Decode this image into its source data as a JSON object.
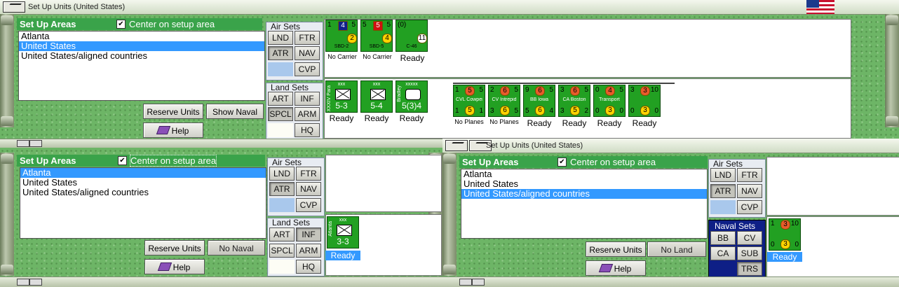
{
  "windows": [
    {
      "id": "top",
      "title": "Set Up Units (United States)",
      "header": "Set Up Areas",
      "center_label": "Center on setup area",
      "center_checked": "✔",
      "areas": [
        "Atlanta",
        "United States",
        "United States/aligned countries"
      ],
      "selected_area": 1,
      "reserve_label": "Reserve Units",
      "second_label": "Show Naval",
      "help_label": "Help",
      "air_sets": {
        "caption": "Air Sets",
        "buttons": [
          "LND",
          "FTR",
          "ATR",
          "NAV",
          "CVP"
        ]
      },
      "land_sets": {
        "caption": "Land Sets",
        "buttons": [
          "ART",
          "INF",
          "SPCL",
          "ARM",
          "HQ"
        ]
      }
    },
    {
      "id": "bottom-left",
      "header": "Set Up Areas",
      "center_label": "Center on setup area",
      "center_checked": "✔",
      "areas": [
        "Atlanta",
        "United States",
        "United States/aligned countries"
      ],
      "selected_area": 0,
      "reserve_label": "Reserve Units",
      "second_label": "No Naval",
      "help_label": "Help",
      "air_sets": {
        "caption": "Air Sets",
        "buttons": [
          "LND",
          "FTR",
          "ATR",
          "NAV",
          "CVP"
        ]
      },
      "land_sets": {
        "caption": "Land Sets",
        "buttons": [
          "ART",
          "INF",
          "SPCL",
          "ARM",
          "HQ"
        ]
      }
    },
    {
      "id": "bottom-right",
      "title": "Set Up Units (United States)",
      "header": "Set Up Areas",
      "center_label": "Center on setup area",
      "center_checked": "✔",
      "areas": [
        "Atlanta",
        "United States",
        "United States/aligned countries"
      ],
      "selected_area": 2,
      "reserve_label": "Reserve Units",
      "second_label": "No Land",
      "help_label": "Help",
      "air_sets": {
        "caption": "Air Sets",
        "buttons": [
          "LND",
          "FTR",
          "ATR",
          "NAV",
          "CVP"
        ]
      },
      "naval_sets": {
        "caption": "Naval Sets",
        "buttons": [
          "BB",
          "CV",
          "CA",
          "SUB",
          "TRS"
        ]
      }
    }
  ],
  "top_air_units": [
    {
      "tl": "1",
      "tr": "5",
      "name": "SBD-2",
      "val": "2",
      "badge": "4",
      "badge_color": "#10208a",
      "under": "No Carrier"
    },
    {
      "tl": "5",
      "tr": "5",
      "name": "SBD-5",
      "val": "4",
      "badge": "5",
      "badge_color": "#d01010",
      "under": "No Carrier"
    },
    {
      "tl": "(0)",
      "tr": "",
      "name": "C-46",
      "val": "11",
      "badge": "",
      "badge_color": "",
      "under": "Ready"
    }
  ],
  "top_land_units": [
    {
      "label": "XXXIV Para",
      "top": "xxx",
      "strength": "5-3",
      "under": "Ready"
    },
    {
      "label": "",
      "top": "xxx",
      "strength": "5-4",
      "under": "Ready"
    },
    {
      "label": "Bradley",
      "top": "xxxxx",
      "strength": "5(3)4",
      "under": "Ready"
    }
  ],
  "top_naval_units": [
    {
      "tl": "1",
      "a": "5",
      "tr": "5",
      "name": "CVL Cowpens",
      "bl": "1",
      "b": "5",
      "br": "1",
      "under": "No Planes"
    },
    {
      "tl": "2",
      "a": "6",
      "tr": "5",
      "name": "CV Intrepid",
      "bl": "3",
      "b": "6",
      "br": "5",
      "under": "No Planes"
    },
    {
      "tl": "9",
      "a": "6",
      "tr": "5",
      "name": "BB Iowa",
      "bl": "5",
      "b": "6",
      "br": "4",
      "under": "Ready"
    },
    {
      "tl": "3",
      "a": "6",
      "tr": "5",
      "name": "CA Boston",
      "bl": "3",
      "b": "5",
      "br": "2",
      "under": "Ready"
    },
    {
      "tl": "0",
      "a": "4",
      "tr": "5",
      "name": "Transport",
      "bl": "0",
      "b": "3",
      "br": "0",
      "under": "Ready"
    },
    {
      "tl": "3",
      "a": "3",
      "tr": "10",
      "name": "",
      "bl": "0",
      "b": "3",
      "br": "0",
      "under": "Ready"
    }
  ],
  "bl_unit": {
    "label": "Atlanta",
    "top": "xxx",
    "strength": "3-3",
    "under": "Ready"
  },
  "br_unit": {
    "tl": "1",
    "a": "3",
    "tr": "10",
    "bl": "0",
    "b": "3",
    "br": "0",
    "under": "Ready"
  }
}
